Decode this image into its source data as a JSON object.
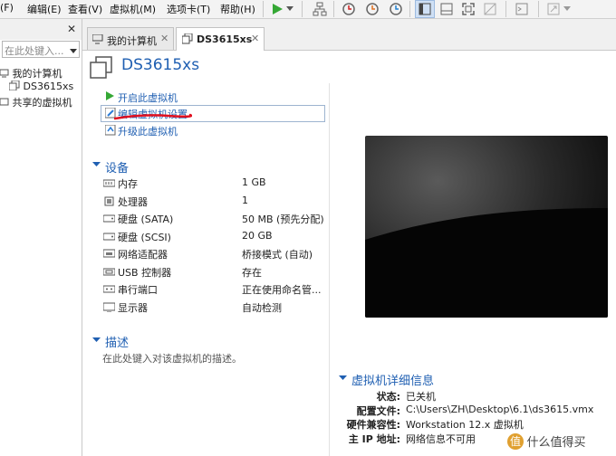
{
  "menubar": {
    "items": [
      "(F)",
      "编辑(E)",
      "查看(V)",
      "虚拟机(M)",
      "选项卡(T)",
      "帮助(H)"
    ]
  },
  "library": {
    "search_placeholder": "在此处键入...",
    "tree": [
      "我的计算机",
      "DS3615xs",
      "共享的虚拟机"
    ]
  },
  "tabs": [
    {
      "label": "我的计算机"
    },
    {
      "label": "DS3615xs"
    }
  ],
  "vm": {
    "title": "DS3615xs",
    "actions": [
      "开启此虚拟机",
      "编辑虚拟机设置",
      "升级此虚拟机"
    ],
    "devices_header": "设备",
    "devices": [
      {
        "name": "内存",
        "value": "1 GB",
        "icon": "memory-icon"
      },
      {
        "name": "处理器",
        "value": "1",
        "icon": "cpu-icon"
      },
      {
        "name": "硬盘 (SATA)",
        "value": "50 MB (预先分配)",
        "icon": "disk-icon"
      },
      {
        "name": "硬盘 (SCSI)",
        "value": "20 GB",
        "icon": "disk-icon"
      },
      {
        "name": "网络适配器",
        "value": "桥接模式 (自动)",
        "icon": "network-icon"
      },
      {
        "name": "USB 控制器",
        "value": "存在",
        "icon": "usb-icon"
      },
      {
        "name": "串行端口",
        "value": "正在使用命名管...",
        "icon": "serial-port-icon"
      },
      {
        "name": "显示器",
        "value": "自动检测",
        "icon": "monitor-icon"
      }
    ],
    "desc_header": "描述",
    "desc_placeholder": "在此处键入对该虚拟机的描述。",
    "details_header": "虚拟机详细信息",
    "details": [
      {
        "key": "状态:",
        "value": "已关机"
      },
      {
        "key": "配置文件:",
        "value": "C:\\Users\\ZH\\Desktop\\6.1\\ds3615.vmx"
      },
      {
        "key": "硬件兼容性:",
        "value": "Workstation 12.x 虚拟机"
      },
      {
        "key": "主 IP 地址:",
        "value": "网络信息不可用"
      }
    ]
  },
  "watermark": "值 什么值得买",
  "colors": {
    "accent": "#1f5fb2",
    "play": "#35a835",
    "annotation": "#e01020"
  }
}
